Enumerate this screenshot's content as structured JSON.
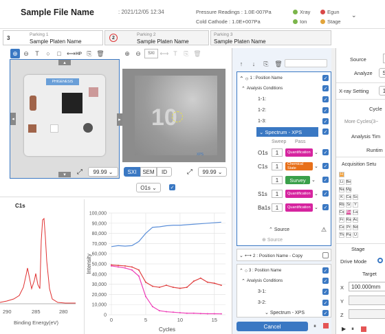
{
  "header": {
    "title": "Sample File Name",
    "date": ": 2021/12/05 12:34",
    "pressure": "Pressure Readings : 1.0E-007Pa",
    "cathode": "Cold Cathode : 1.0E+007Pa",
    "legend": [
      {
        "label": "Xray",
        "color": "#7bb54a"
      },
      {
        "label": "Egun",
        "color": "#d94848"
      },
      {
        "label": "Ion",
        "color": "#7bb54a"
      },
      {
        "label": "Stage",
        "color": "#e2a43a"
      }
    ]
  },
  "tabs": [
    {
      "num": "3",
      "sub": "Parking 1",
      "name": "Sample Platen Name"
    },
    {
      "num": "2",
      "sub": "Parking 2",
      "name": "Sample Platen Name"
    },
    {
      "num": "",
      "sub": "Parking 3",
      "name": "Sample Platen Name"
    }
  ],
  "left": {
    "hp": "HP",
    "platen_label": "PHIGENESIS",
    "zoom1": "99.99",
    "zoom2": "99.99",
    "modes": [
      "SXI",
      "SEM",
      "ID"
    ],
    "element": "O1s",
    "sxi": "SXI"
  },
  "micro_label": "XPS",
  "spectrum": {
    "title": "C1s",
    "xlabel": "Binding Energy(eV)",
    "ticks": [
      "290",
      "285",
      "280"
    ]
  },
  "chart_data": {
    "type": "line",
    "xlabel": "Cycles",
    "ylabel": "Intensity",
    "ylim": [
      0,
      100000
    ],
    "yticks": [
      "100,000",
      "90,000",
      "80,000",
      "70,000",
      "60,000",
      "50,000",
      "40,000",
      "30,000",
      "20,000",
      "10,000",
      "0"
    ],
    "xticks": [
      "0",
      "5",
      "10",
      "15"
    ],
    "series": [
      {
        "color": "#5b8fd9",
        "x": [
          0,
          1,
          2,
          3,
          4,
          5,
          6,
          7,
          8,
          9,
          10,
          11,
          12,
          13,
          14,
          15,
          16
        ],
        "y": [
          67000,
          68000,
          67500,
          68000,
          72000,
          80000,
          86000,
          86500,
          87500,
          88000,
          88000,
          88500,
          89000,
          89500,
          90000,
          90500,
          91000
        ]
      },
      {
        "color": "#e04040",
        "x": [
          0,
          1,
          2,
          3,
          4,
          5,
          6,
          7,
          8,
          9,
          10,
          11,
          12,
          13,
          14,
          15,
          16
        ],
        "y": [
          49000,
          48500,
          48000,
          47000,
          44000,
          32000,
          28000,
          27000,
          29000,
          27000,
          26000,
          27000,
          33000,
          36000,
          32000,
          31000,
          29000
        ]
      },
      {
        "color": "#ee3fb8",
        "x": [
          0,
          1,
          2,
          3,
          4,
          5,
          6,
          7,
          8,
          9,
          10,
          11,
          12,
          13,
          14,
          15,
          16
        ],
        "y": [
          48000,
          47000,
          46000,
          44000,
          38000,
          18000,
          8000,
          4000,
          3000,
          2500,
          2000,
          1500,
          1500,
          1200,
          1000,
          1000,
          900
        ]
      }
    ]
  },
  "middle": {
    "pos1": "1 : Position Name",
    "cond": "Analysis Conditions",
    "subs1": [
      "1-1:",
      "1-2:",
      "1-3:"
    ],
    "spec": "Spectrum - XPS",
    "sweep": "Sweep",
    "pass": "Pass",
    "elements": [
      {
        "el": "O1s",
        "n": "1",
        "mode": "Quantification",
        "color": "#d6249f"
      },
      {
        "el": "C1s",
        "n": "1",
        "mode": "Chemical State",
        "color": "#e8701a"
      },
      {
        "el": "",
        "n": "1",
        "mode": "Survey",
        "color": "#3aa04a"
      },
      {
        "el": "S1s",
        "n": "1",
        "mode": "Quantification",
        "color": "#d6249f"
      },
      {
        "el": "Ba1s",
        "n": "1",
        "mode": "Quantification",
        "color": "#d6249f"
      }
    ],
    "source": "Source",
    "source_add": "Source",
    "pos2": "2 : Position Name - Copy",
    "pos3": "3 : Position Name",
    "cond3": "Analysis Conditions",
    "subs3": [
      "3-1:",
      "3-2:"
    ],
    "spec3": "Spectrum - XPS",
    "cancel": "Cancel"
  },
  "right": {
    "source": "Source",
    "analyze": "Analyze",
    "analyze_val": "S",
    "xray": "X-ray Setting",
    "xray_val": "1",
    "cycles": "Cycle",
    "more": "More Cycles(3~",
    "atime": "Analysis Tim",
    "runtime": "Runtim",
    "acq": "Acquisition Setu",
    "stage": "Stage",
    "drive": "Drive Mode",
    "target": "Target",
    "x": "X",
    "xval": "100.000mm",
    "y": "Y",
    "z": "Z",
    "pt": [
      [
        "H"
      ],
      [
        "Li",
        "Be"
      ],
      [
        "Na",
        "Mg"
      ],
      [
        "K",
        "Ca",
        "Sc"
      ],
      [
        "Rb",
        "Sr",
        "Y"
      ],
      [
        "Cs",
        "Ba",
        "La"
      ],
      [
        "Fr",
        "Ra",
        "Ac"
      ],
      [
        "Ce",
        "Pr",
        "Nd"
      ],
      [
        "Th",
        "Pa",
        "U"
      ]
    ]
  }
}
